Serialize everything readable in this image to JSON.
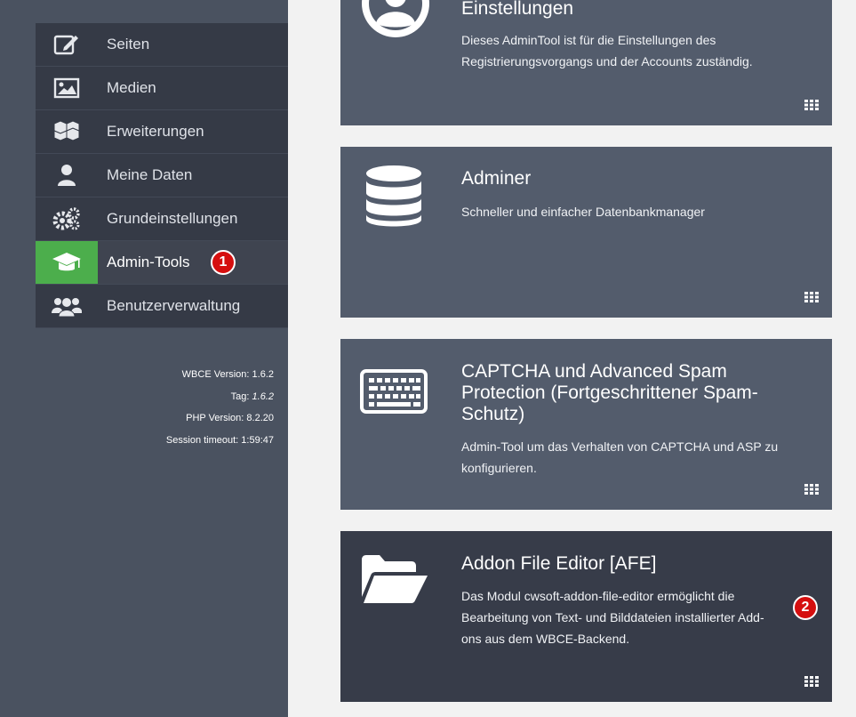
{
  "sidebar": {
    "items": [
      {
        "label": "Seiten",
        "icon": "edit-icon",
        "active": false
      },
      {
        "label": "Medien",
        "icon": "image-icon",
        "active": false
      },
      {
        "label": "Erweiterungen",
        "icon": "cubes-icon",
        "active": false
      },
      {
        "label": "Meine Daten",
        "icon": "user-icon",
        "active": false
      },
      {
        "label": "Grundeinstellungen",
        "icon": "gears-icon",
        "active": false
      },
      {
        "label": "Admin-Tools",
        "icon": "graduation-cap-icon",
        "active": true
      },
      {
        "label": "Benutzerverwaltung",
        "icon": "users-icon",
        "active": false
      }
    ],
    "active_color": "#4cae4c"
  },
  "version_info": {
    "wbce_label": "WBCE Version: 1.6.2",
    "tag_label": "Tag: ",
    "tag_value": "1.6.2",
    "php_label": "PHP Version: 8.2.20",
    "session_label": "Session timeout: 1:59:47"
  },
  "badges": {
    "one": "1",
    "two": "2",
    "color": "#d50f0f"
  },
  "cards": [
    {
      "title": "Einstellungen",
      "description": "Dieses AdminTool ist für die Einstellungen des Registrierungsvorgangs und der Accounts zuständig.",
      "icon": "user-circle-icon"
    },
    {
      "title": "Adminer",
      "description": "Schneller und einfacher Datenbankmanager",
      "icon": "database-icon"
    },
    {
      "title": "CAPTCHA und Advanced Spam Protection (Fortgeschrittener Spam-Schutz)",
      "description": "Admin-Tool um das Verhalten von CAPTCHA und ASP zu konfigurieren.",
      "icon": "keyboard-icon"
    },
    {
      "title": "Addon File Editor [AFE]",
      "description": "Das Modul cwsoft-addon-file-editor ermöglicht die Bearbeitung von Text- und Bilddateien installierter Add-ons aus dem WBCE-Backend.",
      "icon": "folder-open-icon"
    }
  ]
}
